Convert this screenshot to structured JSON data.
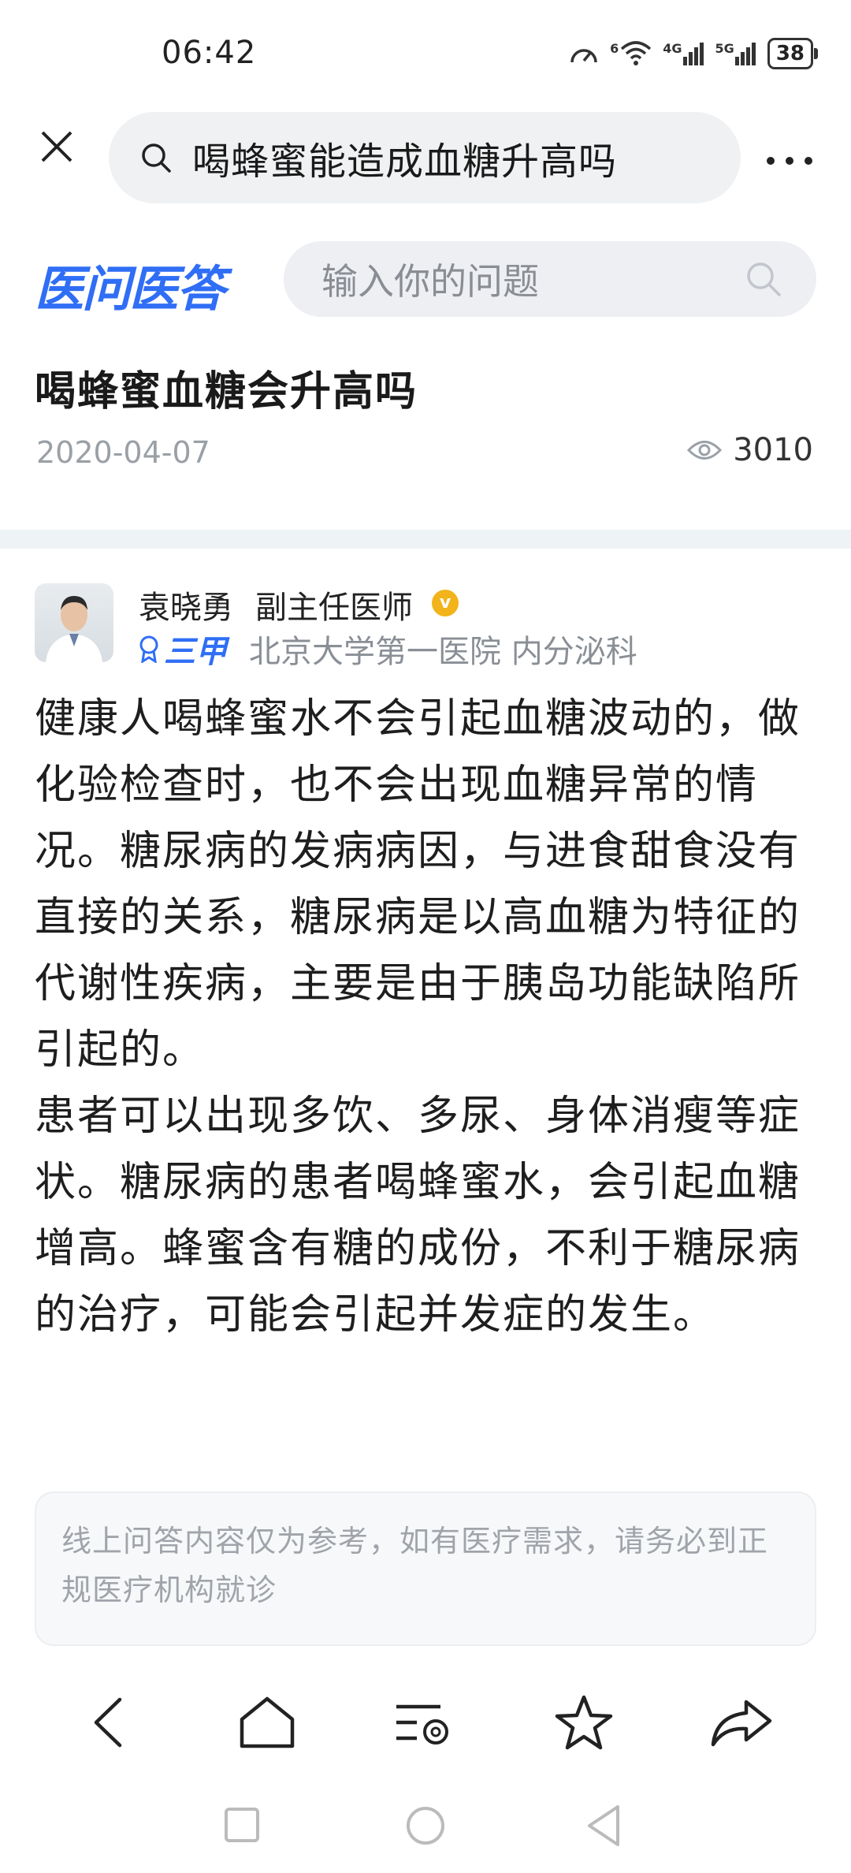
{
  "status_bar": {
    "time": "06:42",
    "battery": "38",
    "network_1": "6",
    "network_2": "4G",
    "network_3": "5G"
  },
  "browser": {
    "search_query": "喝蜂蜜能造成血糖升高吗",
    "icons": {
      "close": "close-icon",
      "search": "search-icon",
      "more": "more-icon"
    }
  },
  "site": {
    "logo": "医问医答",
    "search_placeholder": "输入你的问题"
  },
  "question": {
    "title": "喝蜂蜜血糖会升高吗",
    "date": "2020-04-07",
    "views": "3010"
  },
  "doctor": {
    "name": "袁晓勇",
    "title": "副主任医师",
    "verified": "v",
    "grade": "三甲",
    "hospital": "北京大学第一医院 内分泌科"
  },
  "answer": {
    "paragraphs": [
      "健康人喝蜂蜜水不会引起血糖波动的，做化验检查时，也不会出现血糖异常的情况。糖尿病的发病病因，与进食甜食没有直接的关系，糖尿病是以高血糖为特征的代谢性疾病，主要是由于胰岛功能缺陷所引起的。",
      "患者可以出现多饮、多尿、身体消瘦等症状。糖尿病的患者喝蜂蜜水，会引起血糖增高。蜂蜜含有糖的成份，不利于糖尿病的治疗，可能会引起并发症的发生。"
    ]
  },
  "disclaimer": "线上问答内容仅为参考，如有医疗需求，请务必到正规医疗机构就诊",
  "bottom_nav": [
    "back-icon",
    "home-icon",
    "tabs-icon",
    "star-icon",
    "share-icon"
  ],
  "system_nav": [
    "recent-icon",
    "home-circle-icon",
    "back-triangle-icon"
  ],
  "colors": {
    "brand_blue": "#2f6ef5",
    "badge_gold": "#f2b31b",
    "divider": "#eef3f5"
  }
}
